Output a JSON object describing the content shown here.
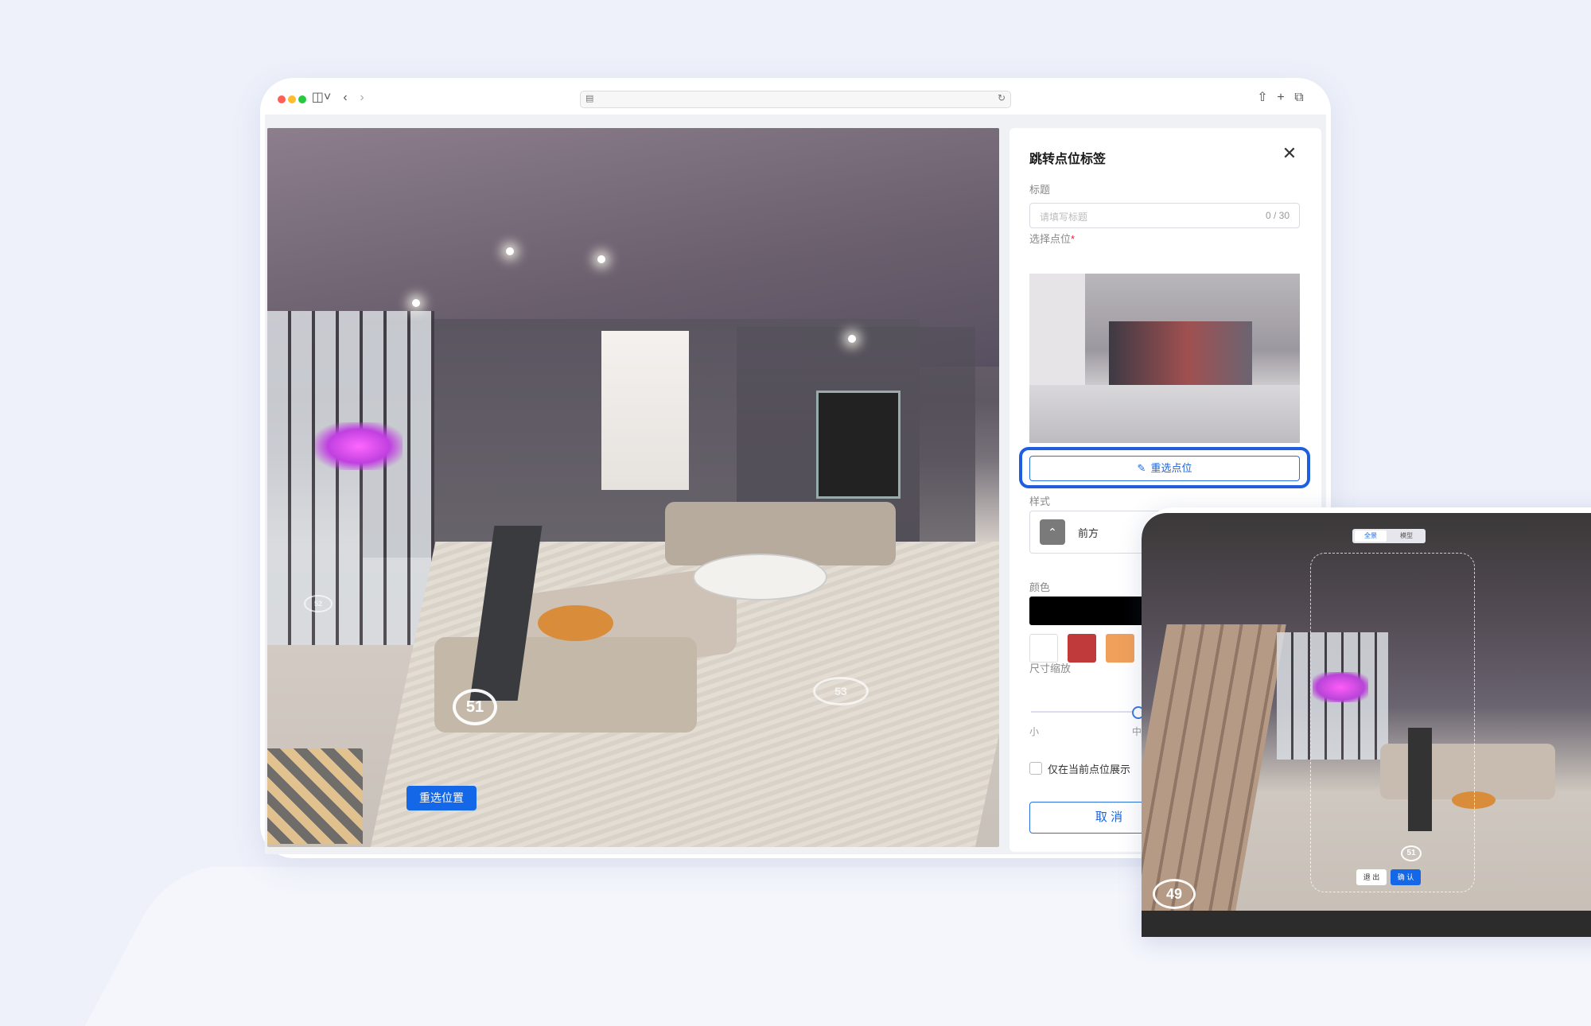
{
  "browser": {
    "traffic_lights": [
      "#ff5f57",
      "#febc2e",
      "#28c840"
    ]
  },
  "panorama": {
    "markers": [
      "51",
      "53",
      "52"
    ],
    "reselect_position_label": "重选位置"
  },
  "panel": {
    "title": "跳转点位标签",
    "title_field": {
      "label": "标题",
      "placeholder": "请填写标题",
      "counter": "0 / 30"
    },
    "point_field": {
      "label": "选择点位",
      "required_mark": "*",
      "reselect_label": "重选点位"
    },
    "style_field": {
      "label": "样式",
      "value": "前方"
    },
    "color_field": {
      "label": "颜色",
      "swatches": [
        "#000000",
        "#ffffff",
        "#c0393b",
        "#f0a05a"
      ]
    },
    "size_field": {
      "label": "尺寸缩放",
      "marks": [
        "小",
        "中"
      ],
      "value": "中"
    },
    "only_current": {
      "label": "仅在当前点位展示",
      "checked": false
    },
    "cancel_label": "取 消"
  },
  "preview": {
    "tabs": [
      "全景",
      "模型"
    ],
    "active_tab": "全景",
    "markers": [
      "51",
      "49"
    ],
    "exit_label": "退 出",
    "confirm_label": "确 认"
  }
}
